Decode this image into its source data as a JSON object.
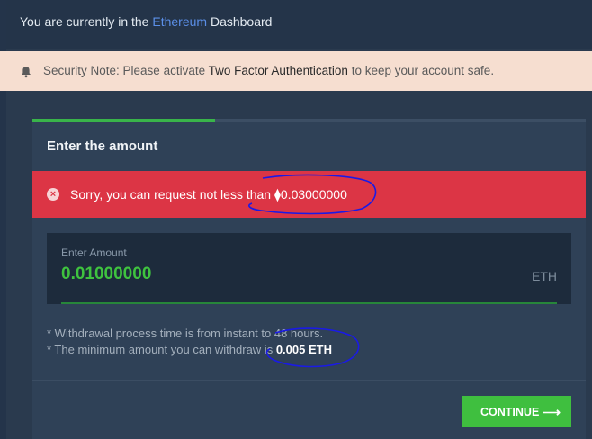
{
  "header": {
    "prefix": "You are currently in the",
    "network": "Ethereum",
    "suffix": "Dashboard"
  },
  "security_note": {
    "icon": "bell-icon",
    "prefix": "Security Note: Please activate",
    "emphasis": "Two Factor Authentication",
    "suffix": "to keep your account safe."
  },
  "card": {
    "step_progress": 0.33,
    "title": "Enter the amount",
    "error": {
      "icon": "close-circle-icon",
      "message": "Sorry, you can request not less than ⧫0.03000000"
    },
    "amount_field": {
      "label": "Enter Amount",
      "value": "0.01000000",
      "unit": "ETH"
    },
    "notes": {
      "line1": "*  Withdrawal process time is from instant to 48 hours.",
      "line2_prefix": "*  The minimum amount you can withdraw is",
      "line2_value": "0.005 ETH"
    },
    "continue_label": "CONTINUE",
    "continue_icon": "arrow-right-icon"
  },
  "colors": {
    "accent_green": "#3fbf3f",
    "error_red": "#dc3545",
    "link_blue": "#5b8fe8",
    "annotation_ink": "#1a1ae6"
  }
}
